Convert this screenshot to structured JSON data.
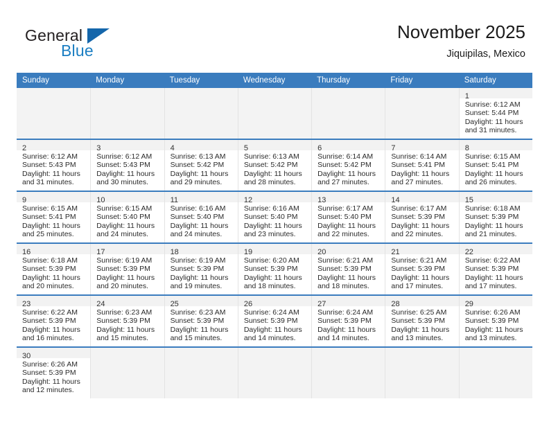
{
  "brand": {
    "name_top": "General",
    "name_bottom": "Blue",
    "accent_color": "#1b7ec2",
    "triangle_color": "#1466ab"
  },
  "header": {
    "title": "November 2025",
    "subtitle": "Jiquipilas, Mexico"
  },
  "theme": {
    "header_row_bg": "#3a7cbe",
    "week_rule_color": "#3a7cbe",
    "daynum_band_bg": "#f2f2f2",
    "cell_divider": "#e3e3e3"
  },
  "weekdays": [
    "Sunday",
    "Monday",
    "Tuesday",
    "Wednesday",
    "Thursday",
    "Friday",
    "Saturday"
  ],
  "weeks": [
    [
      {
        "day": "",
        "sunrise": "",
        "sunset": "",
        "daylight1": "",
        "daylight2": "",
        "empty": true
      },
      {
        "day": "",
        "sunrise": "",
        "sunset": "",
        "daylight1": "",
        "daylight2": "",
        "empty": true
      },
      {
        "day": "",
        "sunrise": "",
        "sunset": "",
        "daylight1": "",
        "daylight2": "",
        "empty": true
      },
      {
        "day": "",
        "sunrise": "",
        "sunset": "",
        "daylight1": "",
        "daylight2": "",
        "empty": true
      },
      {
        "day": "",
        "sunrise": "",
        "sunset": "",
        "daylight1": "",
        "daylight2": "",
        "empty": true
      },
      {
        "day": "",
        "sunrise": "",
        "sunset": "",
        "daylight1": "",
        "daylight2": "",
        "empty": true
      },
      {
        "day": "1",
        "sunrise": "Sunrise: 6:12 AM",
        "sunset": "Sunset: 5:44 PM",
        "daylight1": "Daylight: 11 hours",
        "daylight2": "and 31 minutes.",
        "empty": false
      }
    ],
    [
      {
        "day": "2",
        "sunrise": "Sunrise: 6:12 AM",
        "sunset": "Sunset: 5:43 PM",
        "daylight1": "Daylight: 11 hours",
        "daylight2": "and 31 minutes.",
        "empty": false
      },
      {
        "day": "3",
        "sunrise": "Sunrise: 6:12 AM",
        "sunset": "Sunset: 5:43 PM",
        "daylight1": "Daylight: 11 hours",
        "daylight2": "and 30 minutes.",
        "empty": false
      },
      {
        "day": "4",
        "sunrise": "Sunrise: 6:13 AM",
        "sunset": "Sunset: 5:42 PM",
        "daylight1": "Daylight: 11 hours",
        "daylight2": "and 29 minutes.",
        "empty": false
      },
      {
        "day": "5",
        "sunrise": "Sunrise: 6:13 AM",
        "sunset": "Sunset: 5:42 PM",
        "daylight1": "Daylight: 11 hours",
        "daylight2": "and 28 minutes.",
        "empty": false
      },
      {
        "day": "6",
        "sunrise": "Sunrise: 6:14 AM",
        "sunset": "Sunset: 5:42 PM",
        "daylight1": "Daylight: 11 hours",
        "daylight2": "and 27 minutes.",
        "empty": false
      },
      {
        "day": "7",
        "sunrise": "Sunrise: 6:14 AM",
        "sunset": "Sunset: 5:41 PM",
        "daylight1": "Daylight: 11 hours",
        "daylight2": "and 27 minutes.",
        "empty": false
      },
      {
        "day": "8",
        "sunrise": "Sunrise: 6:15 AM",
        "sunset": "Sunset: 5:41 PM",
        "daylight1": "Daylight: 11 hours",
        "daylight2": "and 26 minutes.",
        "empty": false
      }
    ],
    [
      {
        "day": "9",
        "sunrise": "Sunrise: 6:15 AM",
        "sunset": "Sunset: 5:41 PM",
        "daylight1": "Daylight: 11 hours",
        "daylight2": "and 25 minutes.",
        "empty": false
      },
      {
        "day": "10",
        "sunrise": "Sunrise: 6:15 AM",
        "sunset": "Sunset: 5:40 PM",
        "daylight1": "Daylight: 11 hours",
        "daylight2": "and 24 minutes.",
        "empty": false
      },
      {
        "day": "11",
        "sunrise": "Sunrise: 6:16 AM",
        "sunset": "Sunset: 5:40 PM",
        "daylight1": "Daylight: 11 hours",
        "daylight2": "and 24 minutes.",
        "empty": false
      },
      {
        "day": "12",
        "sunrise": "Sunrise: 6:16 AM",
        "sunset": "Sunset: 5:40 PM",
        "daylight1": "Daylight: 11 hours",
        "daylight2": "and 23 minutes.",
        "empty": false
      },
      {
        "day": "13",
        "sunrise": "Sunrise: 6:17 AM",
        "sunset": "Sunset: 5:40 PM",
        "daylight1": "Daylight: 11 hours",
        "daylight2": "and 22 minutes.",
        "empty": false
      },
      {
        "day": "14",
        "sunrise": "Sunrise: 6:17 AM",
        "sunset": "Sunset: 5:39 PM",
        "daylight1": "Daylight: 11 hours",
        "daylight2": "and 22 minutes.",
        "empty": false
      },
      {
        "day": "15",
        "sunrise": "Sunrise: 6:18 AM",
        "sunset": "Sunset: 5:39 PM",
        "daylight1": "Daylight: 11 hours",
        "daylight2": "and 21 minutes.",
        "empty": false
      }
    ],
    [
      {
        "day": "16",
        "sunrise": "Sunrise: 6:18 AM",
        "sunset": "Sunset: 5:39 PM",
        "daylight1": "Daylight: 11 hours",
        "daylight2": "and 20 minutes.",
        "empty": false
      },
      {
        "day": "17",
        "sunrise": "Sunrise: 6:19 AM",
        "sunset": "Sunset: 5:39 PM",
        "daylight1": "Daylight: 11 hours",
        "daylight2": "and 20 minutes.",
        "empty": false
      },
      {
        "day": "18",
        "sunrise": "Sunrise: 6:19 AM",
        "sunset": "Sunset: 5:39 PM",
        "daylight1": "Daylight: 11 hours",
        "daylight2": "and 19 minutes.",
        "empty": false
      },
      {
        "day": "19",
        "sunrise": "Sunrise: 6:20 AM",
        "sunset": "Sunset: 5:39 PM",
        "daylight1": "Daylight: 11 hours",
        "daylight2": "and 18 minutes.",
        "empty": false
      },
      {
        "day": "20",
        "sunrise": "Sunrise: 6:21 AM",
        "sunset": "Sunset: 5:39 PM",
        "daylight1": "Daylight: 11 hours",
        "daylight2": "and 18 minutes.",
        "empty": false
      },
      {
        "day": "21",
        "sunrise": "Sunrise: 6:21 AM",
        "sunset": "Sunset: 5:39 PM",
        "daylight1": "Daylight: 11 hours",
        "daylight2": "and 17 minutes.",
        "empty": false
      },
      {
        "day": "22",
        "sunrise": "Sunrise: 6:22 AM",
        "sunset": "Sunset: 5:39 PM",
        "daylight1": "Daylight: 11 hours",
        "daylight2": "and 17 minutes.",
        "empty": false
      }
    ],
    [
      {
        "day": "23",
        "sunrise": "Sunrise: 6:22 AM",
        "sunset": "Sunset: 5:39 PM",
        "daylight1": "Daylight: 11 hours",
        "daylight2": "and 16 minutes.",
        "empty": false
      },
      {
        "day": "24",
        "sunrise": "Sunrise: 6:23 AM",
        "sunset": "Sunset: 5:39 PM",
        "daylight1": "Daylight: 11 hours",
        "daylight2": "and 15 minutes.",
        "empty": false
      },
      {
        "day": "25",
        "sunrise": "Sunrise: 6:23 AM",
        "sunset": "Sunset: 5:39 PM",
        "daylight1": "Daylight: 11 hours",
        "daylight2": "and 15 minutes.",
        "empty": false
      },
      {
        "day": "26",
        "sunrise": "Sunrise: 6:24 AM",
        "sunset": "Sunset: 5:39 PM",
        "daylight1": "Daylight: 11 hours",
        "daylight2": "and 14 minutes.",
        "empty": false
      },
      {
        "day": "27",
        "sunrise": "Sunrise: 6:24 AM",
        "sunset": "Sunset: 5:39 PM",
        "daylight1": "Daylight: 11 hours",
        "daylight2": "and 14 minutes.",
        "empty": false
      },
      {
        "day": "28",
        "sunrise": "Sunrise: 6:25 AM",
        "sunset": "Sunset: 5:39 PM",
        "daylight1": "Daylight: 11 hours",
        "daylight2": "and 13 minutes.",
        "empty": false
      },
      {
        "day": "29",
        "sunrise": "Sunrise: 6:26 AM",
        "sunset": "Sunset: 5:39 PM",
        "daylight1": "Daylight: 11 hours",
        "daylight2": "and 13 minutes.",
        "empty": false
      }
    ],
    [
      {
        "day": "30",
        "sunrise": "Sunrise: 6:26 AM",
        "sunset": "Sunset: 5:39 PM",
        "daylight1": "Daylight: 11 hours",
        "daylight2": "and 12 minutes.",
        "empty": false
      },
      {
        "day": "",
        "sunrise": "",
        "sunset": "",
        "daylight1": "",
        "daylight2": "",
        "empty": true
      },
      {
        "day": "",
        "sunrise": "",
        "sunset": "",
        "daylight1": "",
        "daylight2": "",
        "empty": true
      },
      {
        "day": "",
        "sunrise": "",
        "sunset": "",
        "daylight1": "",
        "daylight2": "",
        "empty": true
      },
      {
        "day": "",
        "sunrise": "",
        "sunset": "",
        "daylight1": "",
        "daylight2": "",
        "empty": true
      },
      {
        "day": "",
        "sunrise": "",
        "sunset": "",
        "daylight1": "",
        "daylight2": "",
        "empty": true
      },
      {
        "day": "",
        "sunrise": "",
        "sunset": "",
        "daylight1": "",
        "daylight2": "",
        "empty": true
      }
    ]
  ]
}
